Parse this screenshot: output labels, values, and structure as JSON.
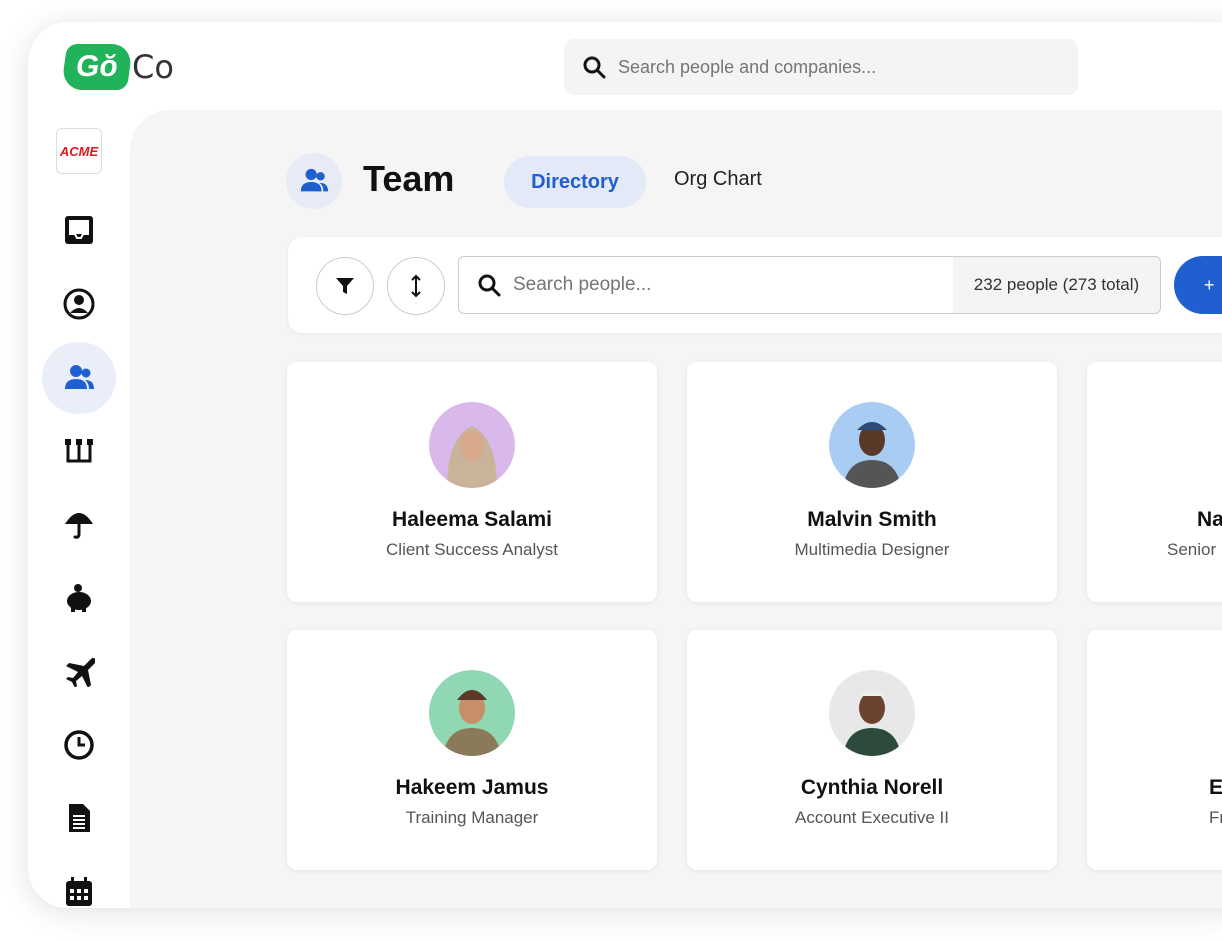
{
  "logo": {
    "badge": "Gŏ",
    "text": "Co"
  },
  "top_search": {
    "placeholder": "Search people and companies..."
  },
  "sidebar": {
    "company_logo": "ACME",
    "items": [
      {
        "icon": "inbox-icon"
      },
      {
        "icon": "user-circle-icon"
      },
      {
        "icon": "team-icon",
        "active": true
      },
      {
        "icon": "org-chart-icon"
      },
      {
        "icon": "umbrella-icon"
      },
      {
        "icon": "piggy-bank-icon"
      },
      {
        "icon": "airplane-icon"
      },
      {
        "icon": "clock-icon"
      },
      {
        "icon": "document-icon"
      },
      {
        "icon": "calendar-icon"
      }
    ]
  },
  "header": {
    "title": "Team",
    "tabs": [
      {
        "label": "Directory",
        "active": true
      },
      {
        "label": "Org Chart",
        "active": false
      }
    ]
  },
  "toolbar": {
    "search_placeholder": "Search people...",
    "count": "232 people (273 total)",
    "add_label": "+"
  },
  "people": [
    {
      "name": "Haleema Salami",
      "role": "Client Success Analyst",
      "avatar_bg": "#d9b8ec"
    },
    {
      "name": "Malvin Smith",
      "role": "Multimedia Designer",
      "avatar_bg": "#a9cdf2"
    },
    {
      "name": "Na",
      "role": "Senior",
      "avatar_bg": "#dddddd"
    },
    {
      "name": "Hakeem Jamus",
      "role": "Training Manager",
      "avatar_bg": "#8fd8b3"
    },
    {
      "name": "Cynthia Norell",
      "role": "Account Executive II",
      "avatar_bg": "#e8e8e8"
    },
    {
      "name": "E",
      "role": "Fro",
      "avatar_bg": "#dddddd"
    }
  ],
  "colors": {
    "accent": "#1f5fd0",
    "brand_green": "#21b35a",
    "tab_active_bg": "#e3e9f6"
  }
}
